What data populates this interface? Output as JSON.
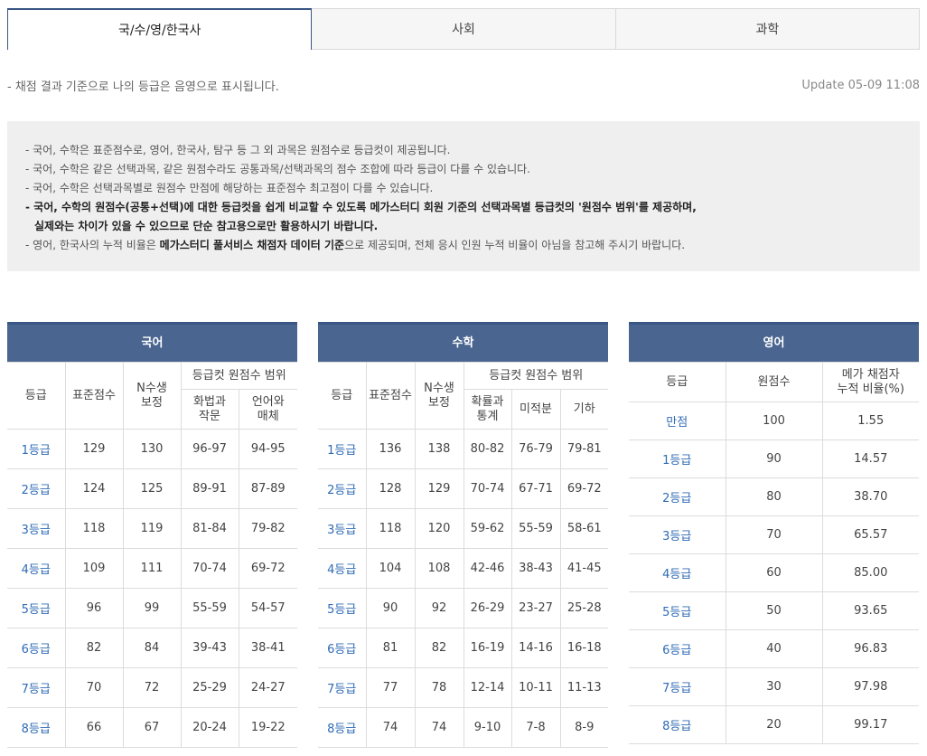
{
  "tabs": [
    {
      "label": "국/수/영/한국사",
      "active": true
    },
    {
      "label": "사회",
      "active": false
    },
    {
      "label": "과학",
      "active": false
    }
  ],
  "note": "- 채점 결과 기준으로 나의 등급은 음영으로 표시됩니다.",
  "update": "Update 05-09 11:08",
  "info": {
    "line1": "- 국어, 수학은 표준점수로, 영어, 한국사, 탐구 등 그 외 과목은 원점수로 등급컷이 제공됩니다.",
    "line2": "- 국어, 수학은 같은 선택과목, 같은 원점수라도 공통과목/선택과목의 점수 조합에 따라 등급이 다를 수 있습니다.",
    "line3": "- 국어, 수학은 선택과목별로 원점수 만점에 해당하는 표준점수 최고점이 다를 수 있습니다.",
    "line4a": "- 국어, 수학의 원점수(공통+선택)에 대한 등급컷을 쉽게 비교할 수 있도록 메가스터디 회원 기준의 선택과목별 등급컷의 '원점수 범위'를 제공하며,",
    "line4b": "실제와는 차이가 있을 수 있으므로 단순 참고용으로만 활용하시기 바랍니다.",
    "line5_pre": "- 영어, 한국사의 누적 비율은 ",
    "line5_bold": "메가스터디 풀서비스 채점자 데이터 기준",
    "line5_post": "으로 제공되며, 전체 응시 인원 누적 비율이 아님을 참고해 주시기 바랍니다."
  },
  "korean": {
    "title": "국어",
    "h_grade": "등급",
    "h_std": "표준점수",
    "h_n": "N수생\n보정",
    "h_range": "등급컷 원점수 범위",
    "h_c1": "화법과\n작문",
    "h_c2": "언어와\n매체",
    "rows": [
      [
        "1등급",
        "129",
        "130",
        "96-97",
        "94-95"
      ],
      [
        "2등급",
        "124",
        "125",
        "89-91",
        "87-89"
      ],
      [
        "3등급",
        "118",
        "119",
        "81-84",
        "79-82"
      ],
      [
        "4등급",
        "109",
        "111",
        "70-74",
        "69-72"
      ],
      [
        "5등급",
        "96",
        "99",
        "55-59",
        "54-57"
      ],
      [
        "6등급",
        "82",
        "84",
        "39-43",
        "38-41"
      ],
      [
        "7등급",
        "70",
        "72",
        "25-29",
        "24-27"
      ],
      [
        "8등급",
        "66",
        "67",
        "20-24",
        "19-22"
      ]
    ]
  },
  "math": {
    "title": "수학",
    "h_grade": "등급",
    "h_std": "표준점수",
    "h_n": "N수생\n보정",
    "h_range": "등급컷 원점수 범위",
    "h_c1": "확률과\n통계",
    "h_c2": "미적분",
    "h_c3": "기하",
    "rows": [
      [
        "1등급",
        "136",
        "138",
        "80-82",
        "76-79",
        "79-81"
      ],
      [
        "2등급",
        "128",
        "129",
        "70-74",
        "67-71",
        "69-72"
      ],
      [
        "3등급",
        "118",
        "120",
        "59-62",
        "55-59",
        "58-61"
      ],
      [
        "4등급",
        "104",
        "108",
        "42-46",
        "38-43",
        "41-45"
      ],
      [
        "5등급",
        "90",
        "92",
        "26-29",
        "23-27",
        "25-28"
      ],
      [
        "6등급",
        "81",
        "82",
        "16-19",
        "14-16",
        "16-18"
      ],
      [
        "7등급",
        "77",
        "78",
        "12-14",
        "10-11",
        "11-13"
      ],
      [
        "8등급",
        "74",
        "74",
        "9-10",
        "7-8",
        "8-9"
      ]
    ]
  },
  "english": {
    "title": "영어",
    "h_grade": "등급",
    "h_raw": "원점수",
    "h_ratio": "메가 채점자\n누적 비율(%)",
    "rows": [
      [
        "만점",
        "100",
        "1.55"
      ],
      [
        "1등급",
        "90",
        "14.57"
      ],
      [
        "2등급",
        "80",
        "38.70"
      ],
      [
        "3등급",
        "70",
        "65.57"
      ],
      [
        "4등급",
        "60",
        "85.00"
      ],
      [
        "5등급",
        "50",
        "93.65"
      ],
      [
        "6등급",
        "40",
        "96.83"
      ],
      [
        "7등급",
        "30",
        "97.98"
      ],
      [
        "8등급",
        "20",
        "99.17"
      ]
    ]
  }
}
